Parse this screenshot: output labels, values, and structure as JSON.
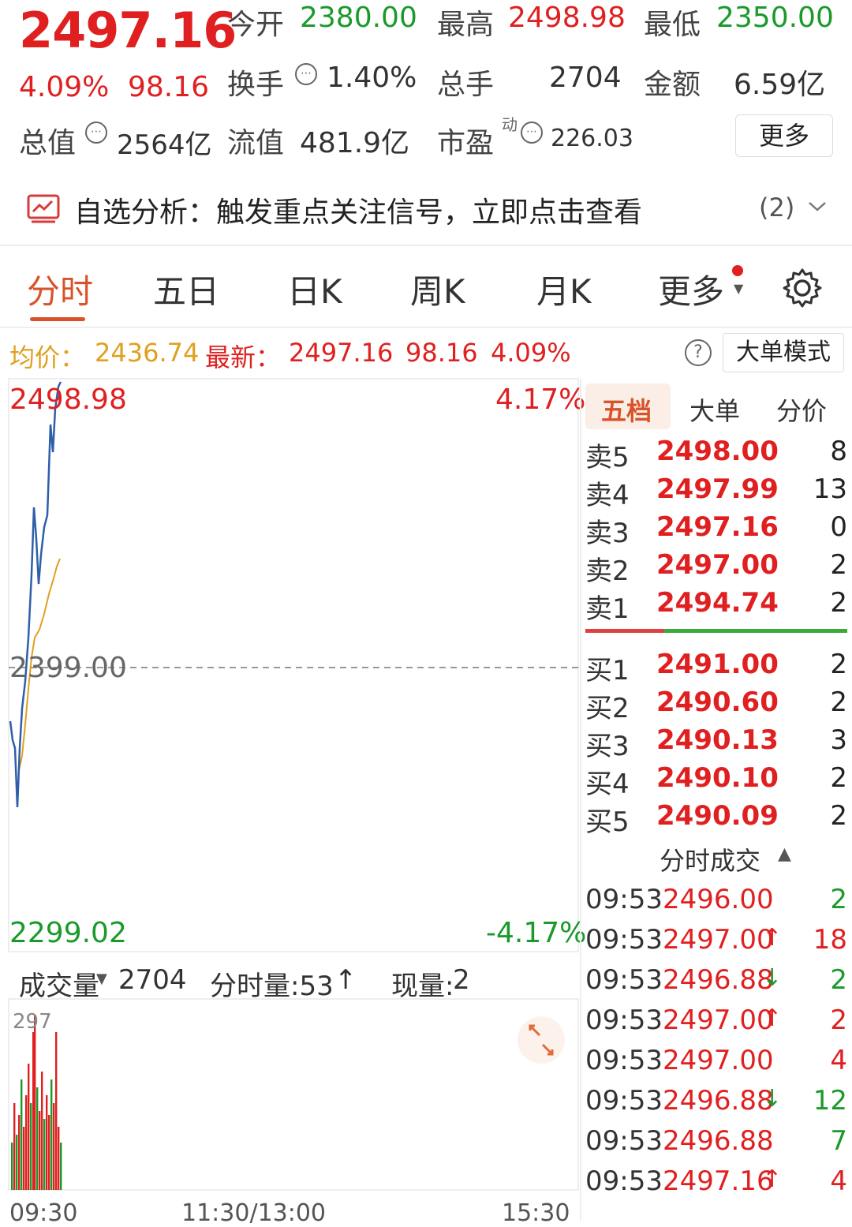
{
  "header": {
    "price": "2497.16",
    "change_pct": "4.09%",
    "change": "98.16",
    "open_label": "今开",
    "open": "2380.00",
    "high_label": "最高",
    "high": "2498.98",
    "low_label": "最低",
    "low": "2350.00",
    "turnover_label": "换手",
    "turnover": "1.40%",
    "volume_label": "总手",
    "volume": "2704",
    "amount_label": "金额",
    "amount": "6.59亿",
    "mktcap_label": "总值",
    "mktcap": "2564亿",
    "float_label": "流值",
    "float": "481.9亿",
    "pe_label": "市盈",
    "pe_sup": "动",
    "pe": "226.03",
    "more_button": "更多"
  },
  "analysis": {
    "text": "自选分析：触发重点关注信号，立即点击查看",
    "count": "(2)"
  },
  "tabs": [
    "分时",
    "五日",
    "日K",
    "周K",
    "月K",
    "更多"
  ],
  "info_line": {
    "avg_label": "均价：",
    "avg": "2436.74",
    "latest_label": "最新：",
    "latest": "2497.16",
    "change": "98.16",
    "pct": "4.09%",
    "mode_button": "大单模式"
  },
  "chart": {
    "top_price": "2498.98",
    "top_pct": "4.17%",
    "mid_price": "2399.00",
    "bottom_price": "2299.02",
    "bottom_pct": "-4.17%",
    "colors": {
      "price": "#2e5fa8",
      "avg": "#e0a020",
      "up": "#e02020",
      "down": "#1a9a2a"
    }
  },
  "orderbook": {
    "tabs": [
      "五档",
      "大单",
      "分价"
    ],
    "asks": [
      {
        "label": "卖5",
        "price": "2498.00",
        "vol": "8"
      },
      {
        "label": "卖4",
        "price": "2497.99",
        "vol": "13"
      },
      {
        "label": "卖3",
        "price": "2497.16",
        "vol": "0"
      },
      {
        "label": "卖2",
        "price": "2497.00",
        "vol": "2"
      },
      {
        "label": "卖1",
        "price": "2494.74",
        "vol": "2"
      }
    ],
    "bids": [
      {
        "label": "买1",
        "price": "2491.00",
        "vol": "2"
      },
      {
        "label": "买2",
        "price": "2490.60",
        "vol": "2"
      },
      {
        "label": "买3",
        "price": "2490.13",
        "vol": "3"
      },
      {
        "label": "买4",
        "price": "2490.10",
        "vol": "2"
      },
      {
        "label": "买5",
        "price": "2490.09",
        "vol": "2"
      }
    ],
    "trades_title": "分时成交",
    "trades": [
      {
        "time": "09:53",
        "price": "2496.00",
        "arrow": "",
        "vol": "2",
        "dir": "down"
      },
      {
        "time": "09:53",
        "price": "2497.00",
        "arrow": "↑",
        "vol": "18",
        "dir": "up"
      },
      {
        "time": "09:53",
        "price": "2496.88",
        "arrow": "↓",
        "vol": "2",
        "dir": "down"
      },
      {
        "time": "09:53",
        "price": "2497.00",
        "arrow": "↑",
        "vol": "2",
        "dir": "up"
      },
      {
        "time": "09:53",
        "price": "2497.00",
        "arrow": "",
        "vol": "4",
        "dir": "up"
      },
      {
        "time": "09:53",
        "price": "2496.88",
        "arrow": "↓",
        "vol": "12",
        "dir": "down"
      },
      {
        "time": "09:53",
        "price": "2496.88",
        "arrow": "",
        "vol": "7",
        "dir": "down"
      },
      {
        "time": "09:53",
        "price": "2497.16",
        "arrow": "↑",
        "vol": "4",
        "dir": "up"
      }
    ]
  },
  "volume": {
    "label": "成交量",
    "total": "2704",
    "tick_label": "分时量:53",
    "tick_arrow": "↑",
    "now_label": "现量:",
    "now": "2",
    "max": "297",
    "times": [
      "09:30",
      "11:30/13:00",
      "15:30"
    ]
  }
}
